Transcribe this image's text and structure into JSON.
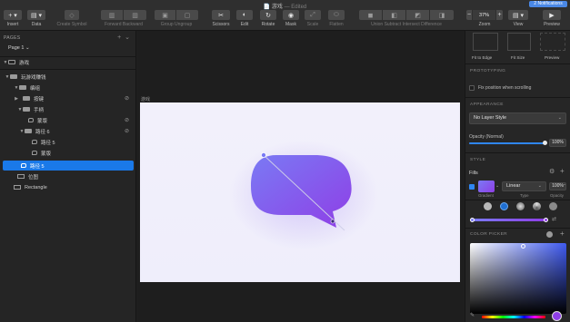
{
  "window": {
    "title": "📄 游戏",
    "edited": "— Edited",
    "notifications": "2 Notifications"
  },
  "toolbar": {
    "insert": "Insert",
    "data": "Data",
    "create_symbol": "Create Symbol",
    "forward": "Forward",
    "backward": "Backward",
    "group": "Group",
    "ungroup": "Ungroup",
    "scissors": "Scissors",
    "edit": "Edit",
    "rotate": "Rotate",
    "mask": "Mask",
    "scale": "Scale",
    "flatten": "Flatten",
    "union": "Union",
    "subtract": "Subtract",
    "intersect": "Intersect",
    "difference": "Difference",
    "zoom_label": "Zoom",
    "zoom_value": "37%",
    "view": "View",
    "preview": "Preview"
  },
  "layers_panel": {
    "pages_heading": "PAGES",
    "current_page": "Page 1 ⌄",
    "layers": [
      {
        "label": "游戏",
        "expanded": true
      },
      {
        "label": "玩游戏赚钱",
        "expanded": true
      },
      {
        "label": "编组",
        "expanded": true
      },
      {
        "label": "按键",
        "expanded": false
      },
      {
        "label": "手柄",
        "expanded": true
      },
      {
        "label": "蒙版"
      },
      {
        "label": "路径 6",
        "expanded": true
      },
      {
        "label": "路径 5"
      },
      {
        "label": "蒙版"
      },
      {
        "label": "路径 5",
        "selected": true
      },
      {
        "label": "位图"
      },
      {
        "label": "Rectangle"
      }
    ]
  },
  "canvas": {
    "artboard_label": "游戏",
    "gradient_start": "#7a7af4",
    "gradient_end": "#8f3ee6",
    "background": "#f0effb"
  },
  "inspector": {
    "fit_to_edge": "Fit to Edge",
    "fit_size": "Fit Size",
    "preview": "Preview",
    "prototyping": "PROTOTYPING",
    "fix_position": "Fix position when scrolling",
    "appearance": "APPEARANCE",
    "layer_style": "No Layer Style",
    "opacity_label": "Opacity (Normal)",
    "opacity_value": "100%",
    "style": "STYLE",
    "fills": "Fills",
    "fill_type": "Linear",
    "fill_opacity": "100%",
    "col_gradient": "Gradient",
    "col_type": "Type",
    "col_opacity": "Opacity",
    "color_picker": "COLOR PICKER"
  }
}
